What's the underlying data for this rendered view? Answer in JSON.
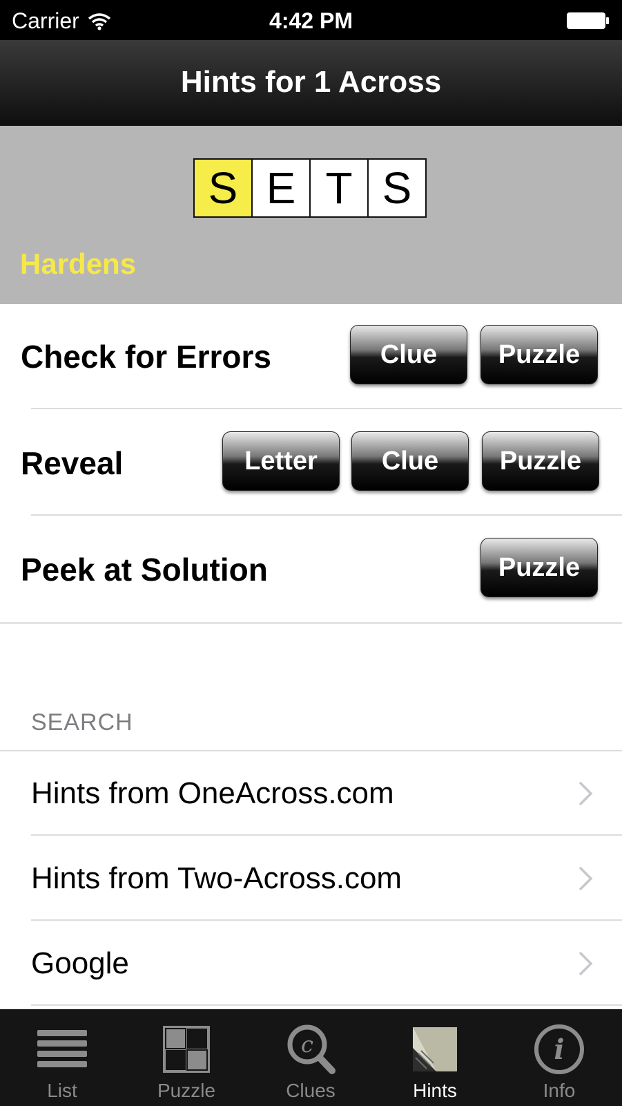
{
  "status_bar": {
    "carrier": "Carrier",
    "time": "4:42 PM"
  },
  "nav": {
    "title": "Hints for 1 Across"
  },
  "clue": {
    "letters": [
      "S",
      "E",
      "T",
      "S"
    ],
    "active_index": 0,
    "text": "Hardens"
  },
  "hints": {
    "check": {
      "label": "Check for Errors",
      "clue_btn": "Clue",
      "puzzle_btn": "Puzzle"
    },
    "reveal": {
      "label": "Reveal",
      "letter_btn": "Letter",
      "clue_btn": "Clue",
      "puzzle_btn": "Puzzle"
    },
    "peek": {
      "label": "Peek at Solution",
      "puzzle_btn": "Puzzle"
    }
  },
  "search": {
    "title": "SEARCH",
    "items": [
      "Hints from OneAcross.com",
      "Hints from Two-Across.com",
      "Google"
    ]
  },
  "tabs": [
    {
      "label": "List",
      "icon": "list-icon"
    },
    {
      "label": "Puzzle",
      "icon": "puzzle-grid-icon"
    },
    {
      "label": "Clues",
      "icon": "clues-magnifier-icon"
    },
    {
      "label": "Hints",
      "icon": "hints-page-icon",
      "selected": true
    },
    {
      "label": "Info",
      "icon": "info-icon"
    }
  ],
  "colors": {
    "highlight": "#f6ec4a",
    "clue_text": "#f7e84a",
    "clue_bg": "#b6b6b6"
  }
}
